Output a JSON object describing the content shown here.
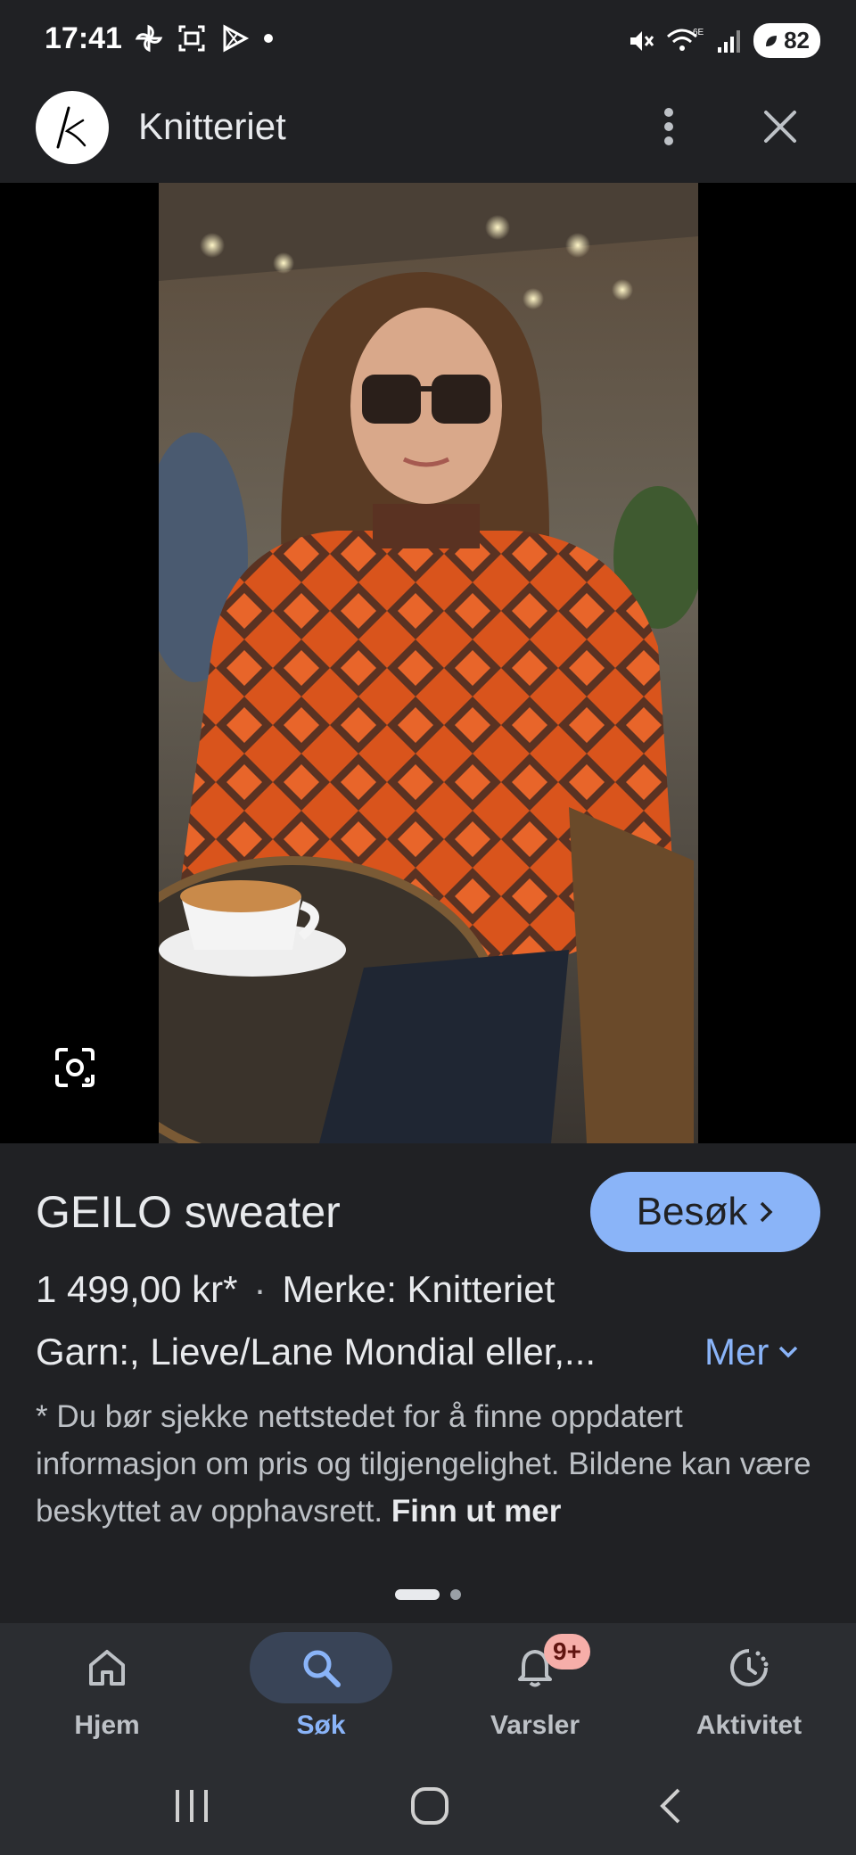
{
  "status_bar": {
    "time": "17:41",
    "battery": "82",
    "left_icons": [
      "pinwheel-icon",
      "screenshot-icon",
      "play-store-icon",
      "dot-icon"
    ],
    "right_icons": [
      "mute-icon",
      "wifi-6e-icon",
      "signal-icon"
    ]
  },
  "header": {
    "site_name": "Knitteriet",
    "avatar_letter": "k"
  },
  "product": {
    "title": "GEILO sweater",
    "visit_label": "Besøk",
    "price": "1 499,00 kr*",
    "separator": "·",
    "brand": "Merke: Knitteriet",
    "description": "Garn:, Lieve/Lane Mondial eller,...",
    "more_label": "Mer",
    "disclaimer": "* Du bør sjekke nettstedet for å finne oppdatert informasjon om pris og tilgjengelighet. Bildene kan være beskyttet av opphavsrett.",
    "learn_more": "Finn ut mer"
  },
  "bottom_nav": {
    "items": [
      {
        "label": "Hjem",
        "icon": "home-icon"
      },
      {
        "label": "Søk",
        "icon": "search-icon",
        "active": true
      },
      {
        "label": "Varsler",
        "icon": "bell-icon",
        "badge": "9+"
      },
      {
        "label": "Aktivitet",
        "icon": "activity-icon"
      }
    ]
  },
  "colors": {
    "background": "#202124",
    "accent": "#8ab4f8",
    "nav_background": "#2b2d31"
  }
}
